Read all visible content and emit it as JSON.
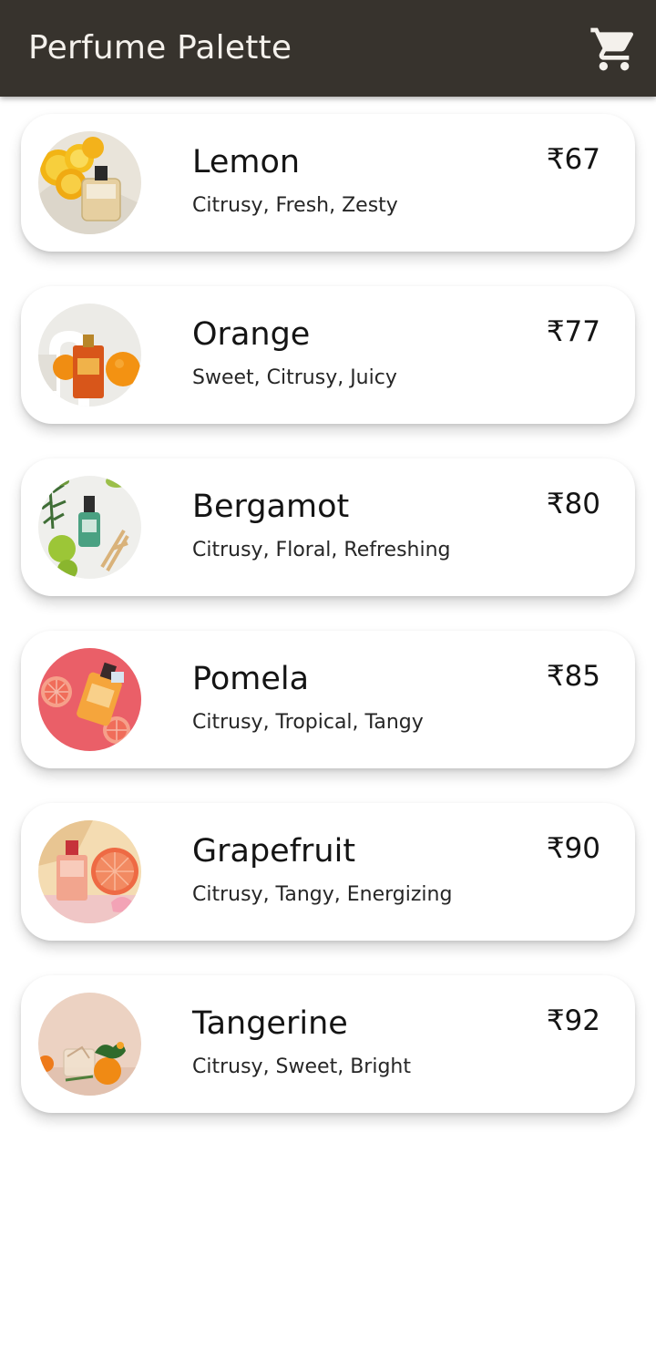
{
  "app_bar": {
    "title": "Perfume Palette",
    "background": "#37332d",
    "cart_icon": "shopping-cart-icon"
  },
  "products": [
    {
      "name": "Lemon",
      "notes": "Citrusy, Fresh, Zesty",
      "price": "₹67"
    },
    {
      "name": "Orange",
      "notes": "Sweet, Citrusy, Juicy",
      "price": "₹77"
    },
    {
      "name": "Bergamot",
      "notes": "Citrusy, Floral, Refreshing",
      "price": "₹80"
    },
    {
      "name": "Pomela",
      "notes": "Citrusy, Tropical, Tangy",
      "price": "₹85"
    },
    {
      "name": "Grapefruit",
      "notes": "Citrusy, Tangy, Energizing",
      "price": "₹90"
    },
    {
      "name": "Tangerine",
      "notes": "Citrusy, Sweet, Bright",
      "price": "₹92"
    }
  ]
}
